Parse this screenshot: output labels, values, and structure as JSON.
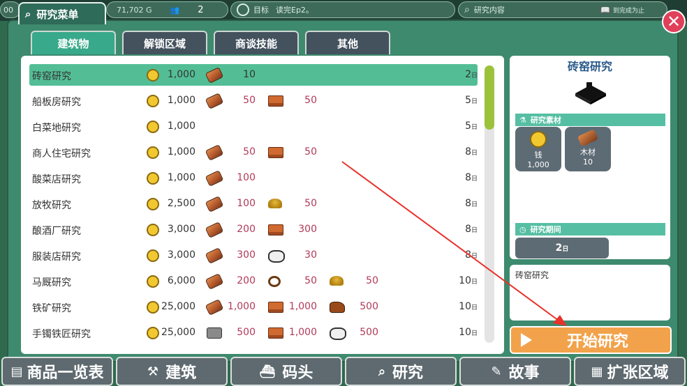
{
  "topbar": {
    "left_text": "00",
    "money": "71,702 G",
    "population": "2",
    "goal_label": "目标",
    "goal_text": "读完Ep2。",
    "search_placeholder": "研究内容",
    "until_done": "到完成为止"
  },
  "panel": {
    "title": "研究菜单",
    "close": "✕"
  },
  "tabs": [
    {
      "label": "建筑物",
      "active": true
    },
    {
      "label": "解锁区域",
      "active": false
    },
    {
      "label": "商谈技能",
      "active": false
    },
    {
      "label": "其他",
      "active": false
    }
  ],
  "rows": [
    {
      "name": "砖窑研究",
      "money": "1,000",
      "mats": [
        {
          "icon": "wood-icon",
          "qty": "10"
        }
      ],
      "days": "2",
      "selected": true
    },
    {
      "name": "船板房研究",
      "money": "1,000",
      "mats": [
        {
          "icon": "wood-icon",
          "qty": "50"
        },
        {
          "icon": "brick-icon",
          "qty": "50"
        }
      ],
      "days": "5"
    },
    {
      "name": "白菜地研究",
      "money": "1,000",
      "mats": [],
      "days": "5"
    },
    {
      "name": "商人住宅研究",
      "money": "1,000",
      "mats": [
        {
          "icon": "wood-icon",
          "qty": "50"
        },
        {
          "icon": "brick-icon",
          "qty": "50"
        }
      ],
      "days": "8"
    },
    {
      "name": "酸菜店研究",
      "money": "1,000",
      "mats": [
        {
          "icon": "wood-icon",
          "qty": "100"
        }
      ],
      "days": "8"
    },
    {
      "name": "放牧研究",
      "money": "2,500",
      "mats": [
        {
          "icon": "wood-icon",
          "qty": "100"
        },
        {
          "icon": "wheat-icon",
          "qty": "50"
        }
      ],
      "days": "8"
    },
    {
      "name": "酿酒厂研究",
      "money": "3,000",
      "mats": [
        {
          "icon": "wood-icon",
          "qty": "200"
        },
        {
          "icon": "brick-icon",
          "qty": "300"
        }
      ],
      "days": "8"
    },
    {
      "name": "服装店研究",
      "money": "3,000",
      "mats": [
        {
          "icon": "wood-icon",
          "qty": "300"
        },
        {
          "icon": "sheep-icon",
          "qty": "30"
        }
      ],
      "days": "8"
    },
    {
      "name": "马厩研究",
      "money": "6,000",
      "mats": [
        {
          "icon": "wood-icon",
          "qty": "200"
        },
        {
          "icon": "rope-icon",
          "qty": "50"
        },
        {
          "icon": "wheat-icon",
          "qty": "50"
        }
      ],
      "days": "10"
    },
    {
      "name": "铁矿研究",
      "money": "25,000",
      "mats": [
        {
          "icon": "wood-icon",
          "qty": "1,000"
        },
        {
          "icon": "brick-icon",
          "qty": "1,000"
        },
        {
          "icon": "horse-icon",
          "qty": "500"
        }
      ],
      "days": "10"
    },
    {
      "name": "手镯铁匠研究",
      "money": "25,000",
      "mats": [
        {
          "icon": "stone-icon",
          "qty": "500"
        },
        {
          "icon": "brick-icon",
          "qty": "1,000"
        },
        {
          "icon": "sheep-icon",
          "qty": "500"
        }
      ],
      "days": "10"
    }
  ],
  "day_unit": "日",
  "detail": {
    "title": "砖窑研究",
    "materials_header": "研究素材",
    "materials": [
      {
        "name": "钱",
        "qty": "1,000"
      },
      {
        "name": "木材",
        "qty": "10"
      }
    ],
    "period_header": "研究期间",
    "period_days": "2",
    "description": "砖窑研究",
    "start_button": "开始研究"
  },
  "bottom_nav": [
    "商品一览表",
    "建筑",
    "码头",
    "研究",
    "故事",
    "扩张区域"
  ],
  "colors": {
    "selected_row": "#53be96",
    "accent_orange": "#f2a24a",
    "close_red": "#e0405a"
  }
}
